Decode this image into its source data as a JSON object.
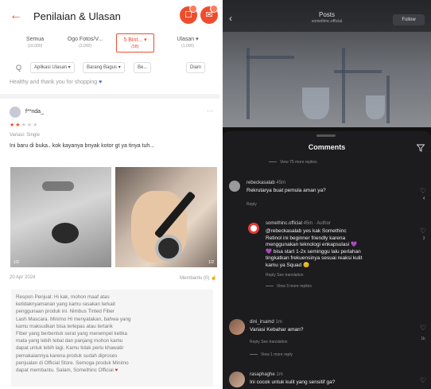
{
  "left": {
    "header": {
      "title": "Penilaian & Ulasan",
      "cart_badge": "1",
      "chat_badge": "1"
    },
    "sort_tabs": [
      {
        "label": "Semua",
        "sub": "(10.000)"
      },
      {
        "label": "Ogo Fotos/V...",
        "sub": "(3.000)"
      },
      {
        "label": "5 Bint... ▾",
        "sub": "(5B)"
      },
      {
        "label": "Ulasan ▾",
        "sub": "(1.000)"
      }
    ],
    "filters": {
      "search_glyph": "Q",
      "chips": [
        "Aplikasi Ulasan ▾",
        "Barang Bagus ▾",
        "Be...",
        "Diam"
      ]
    },
    "thanks_line": "Healthy and thank you for shopping",
    "review": {
      "reviewer_name": "f**nda_",
      "stars_filled": 2,
      "stars_total": 5,
      "variant": "Variasi: Single",
      "text": "Ini baru di buka.. kok kayanya bnyak kotor gt ya tinya tuh...",
      "photo_count": "1/2",
      "photo_index": "1/2",
      "date": "20 Apr 2024",
      "helpful": "Membantu (0)"
    },
    "seller_reply": [
      "Respon Penjual: Hi kak, mohon maaf atas",
      "ketidaknyamanan yang kamu rasakan terkait",
      "penggunaan produk ini. Nimbus Tinted Fiber",
      "Lash Mascara. Minimo Hi menyatakan, bahwa yang",
      "kamu maksudkan bisa terlepas atau tertarik",
      "Fiber yang berbentuk serat yang menempel ketika",
      "mata yang lebih tebal dan panjang  mohon kamu",
      "dapat untuk lebih lagi. Kamu tidak perlu khawatir",
      "pemakaiannya karena produk sudah diproses",
      "penjualan di Official Store. Semoga produk Minimo",
      "dapat membantu. Salam, Somethinc Official"
    ]
  },
  "right": {
    "top": {
      "title": "Posts",
      "subtitle": "somethinc.official",
      "follow_label": "Follow"
    },
    "comments_title": "Comments",
    "view_more_top": "View 75 more replies",
    "comments": [
      {
        "user": "rebeckasalab",
        "time": "45m",
        "lines": [
          "Rekrutarya buat pemula aman ya?"
        ],
        "meta": "Reply",
        "likes": "4"
      },
      {
        "user": "somethinc.official",
        "time": "45m · Author",
        "lines": [
          "@rebeckasalab yes kak Somethinc",
          "Retinol ini beginner friendly karena",
          "menggunakan teknologi enkapsulasi 💜",
          "💜 bisa start 1-2x seminggu lalu perlahan",
          "tingkatkan frekuensinya sesuai reaksi kulit",
          "kamu ya Squad 😊"
        ],
        "meta": "Reply     See translation",
        "likes": "3"
      },
      {
        "user": "dini_irsamd",
        "time": "1m",
        "lines": [
          "Variasi Kebahar aman?"
        ],
        "meta": "Reply     See translation",
        "likes": "1k"
      },
      {
        "user": "rasaphaghe",
        "time": "1m",
        "lines": [
          "Ini cocok untuk kulit yang sensitif ga?"
        ],
        "meta": "",
        "likes": ""
      }
    ],
    "view_replies_2": "View 3 more replies",
    "view_replies_3": "View 1 more reply"
  }
}
